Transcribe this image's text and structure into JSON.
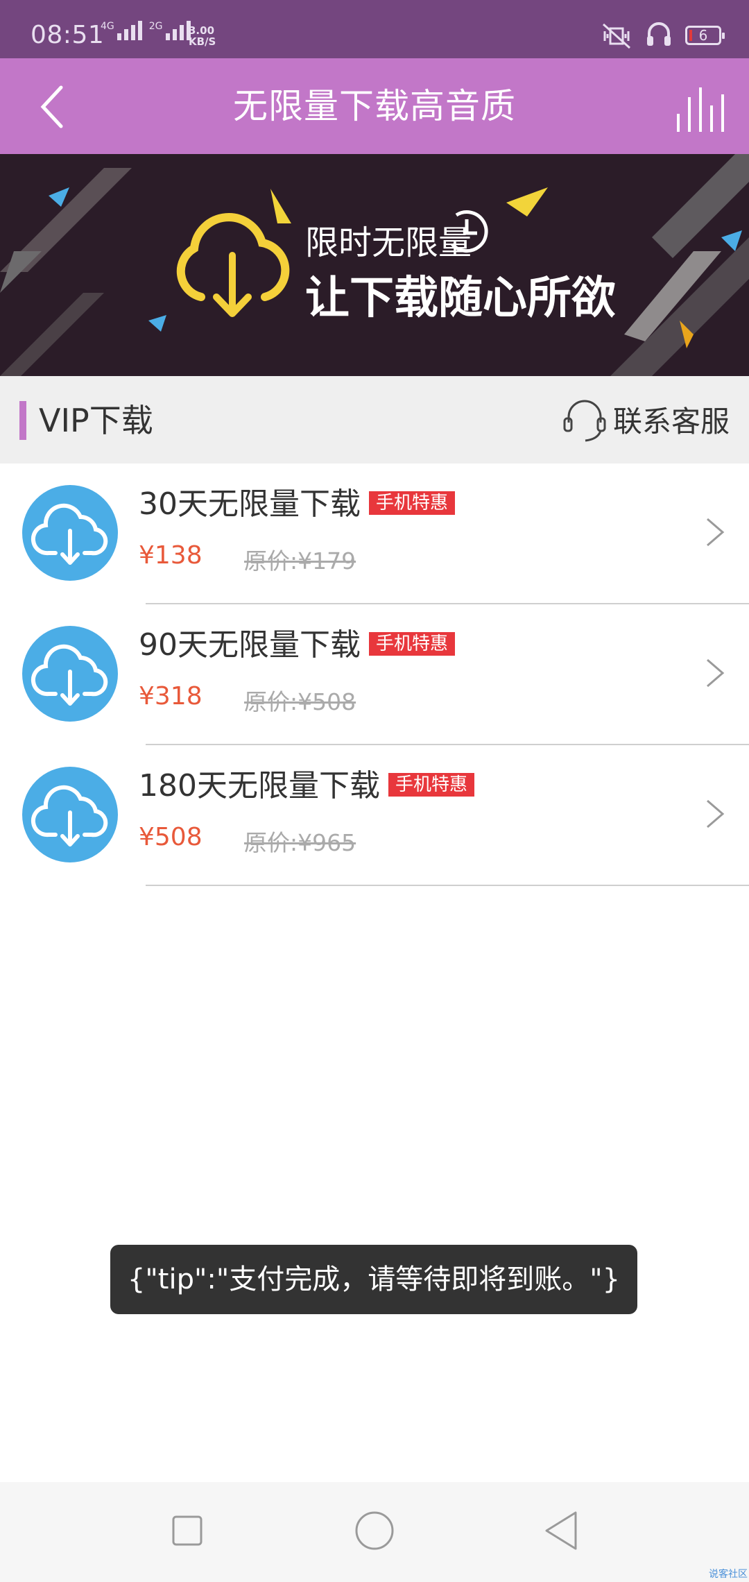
{
  "status_bar": {
    "time": "08:51",
    "net1": "4G",
    "net2": "2G",
    "speed_value": "3.00",
    "speed_unit": "KB/S",
    "battery": "6"
  },
  "app_bar": {
    "title": "无限量下载高音质"
  },
  "banner": {
    "line1": "限时无限量",
    "line2": "让下载随心所欲"
  },
  "section": {
    "title": "VIP下载",
    "support_label": "联系客服"
  },
  "plans": [
    {
      "name": "30天无限量下载",
      "badge": "手机特惠",
      "price": "¥138",
      "original": "原价:¥179"
    },
    {
      "name": "90天无限量下载",
      "badge": "手机特惠",
      "price": "¥318",
      "original": "原价:¥508"
    },
    {
      "name": "180天无限量下载",
      "badge": "手机特惠",
      "price": "¥508",
      "original": "原价:¥965"
    }
  ],
  "toast": {
    "text": "{\"tip\":\"支付完成，请等待即将到账。\"}"
  },
  "watermark": "说客社区",
  "colors": {
    "status_bar": "#74467f",
    "app_bar": "#c277c8",
    "accent": "#c277c8",
    "icon_circle": "#4bade6",
    "price": "#e8593a",
    "badge": "#e8373c",
    "toast_bg": "#333333"
  }
}
